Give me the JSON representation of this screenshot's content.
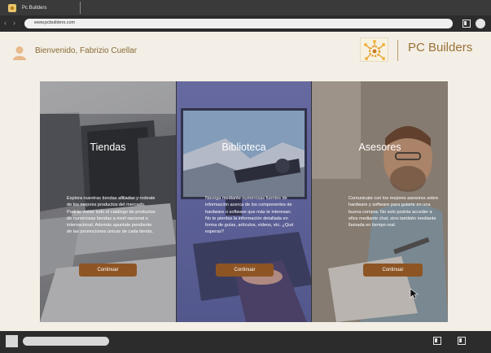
{
  "browser": {
    "tab_title": "Pc Builders",
    "url": "www.pcbuilders.com"
  },
  "header": {
    "greeting": "Bienvenido, Fabrizio Cuellar",
    "brand": "PC Builders"
  },
  "cards": [
    {
      "title": "Tiendas",
      "text": "Explora nuestras tiendas afiliadas y rodeate de los mejores productos del mercado. Podrás visitar todo el catálogo de productos de numerosas tiendas a nivel nacional e internacional. Además apuntate pendiente de las promociones únicas de cada tienda.",
      "button": "Continuar"
    },
    {
      "title": "Biblioteca",
      "text": "Navega mediante numerosas fuentes de información acerca de los componentes de hardware o software que más te interesan. No te pierdas la información detallada en forma de guías, artículos, videos, etc. ¿Qué esperas?",
      "button": "Continuar"
    },
    {
      "title": "Asesores",
      "text": "Comunicate con los mejores asesores sobre hardware y software para guiarte en una buena compra. No solo podrás acceder a ellos mediante chat, sino también mediante llamada en tiempo real.",
      "button": "Continuar"
    }
  ],
  "colors": {
    "accent_button": "#8e5524",
    "brand_text": "#9a7035",
    "chrome": "#2c2c2c",
    "page_bg": "#f3efe6"
  }
}
